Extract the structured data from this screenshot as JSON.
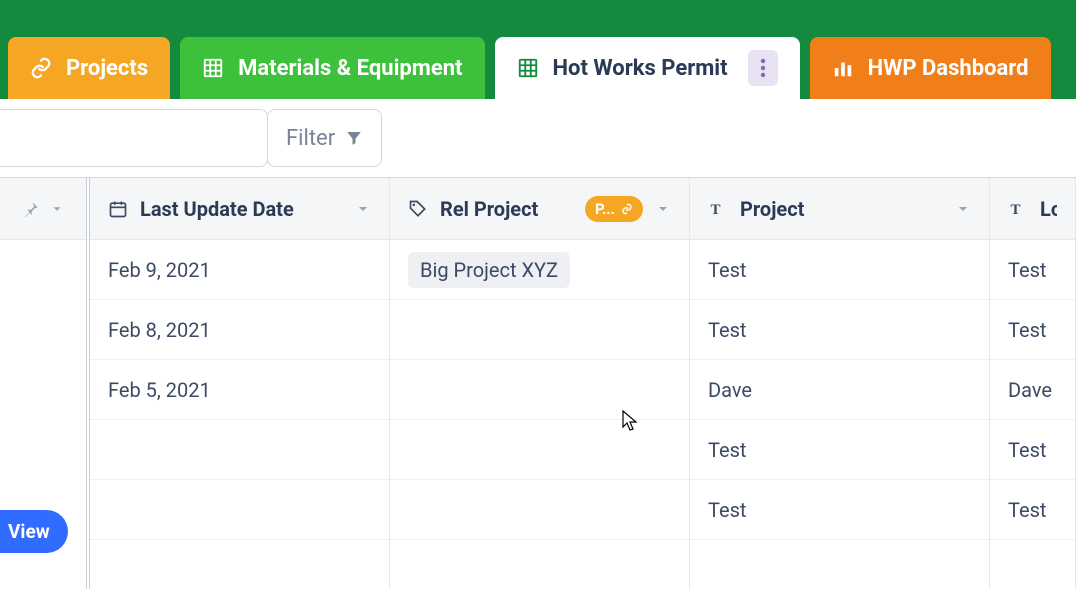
{
  "tabs": {
    "projects": {
      "label": "Projects"
    },
    "materials": {
      "label": "Materials & Equipment"
    },
    "hotworks": {
      "label": "Hot Works Permit"
    },
    "dashboard": {
      "label": "HWP Dashboard"
    }
  },
  "toolbar": {
    "filter_label": "Filter"
  },
  "columns": {
    "date": {
      "label": "Last Update Date"
    },
    "relproj": {
      "label": "Rel Project",
      "pill": "P..."
    },
    "project": {
      "label": "Project"
    },
    "loc": {
      "label": "Loc"
    }
  },
  "rows": [
    {
      "date": "Feb 9, 2021",
      "relproj": "Big Project XYZ",
      "project": "Test",
      "loc": "Test"
    },
    {
      "date": "Feb 8, 2021",
      "relproj": "",
      "project": "Test",
      "loc": "Test"
    },
    {
      "date": "Feb 5, 2021",
      "relproj": "",
      "project": "Dave",
      "loc": "Dave"
    },
    {
      "date": "",
      "relproj": "",
      "project": "Test",
      "loc": "Test"
    },
    {
      "date": "",
      "relproj": "",
      "project": "Test",
      "loc": "Test"
    }
  ],
  "view_fab": {
    "label": "View"
  }
}
